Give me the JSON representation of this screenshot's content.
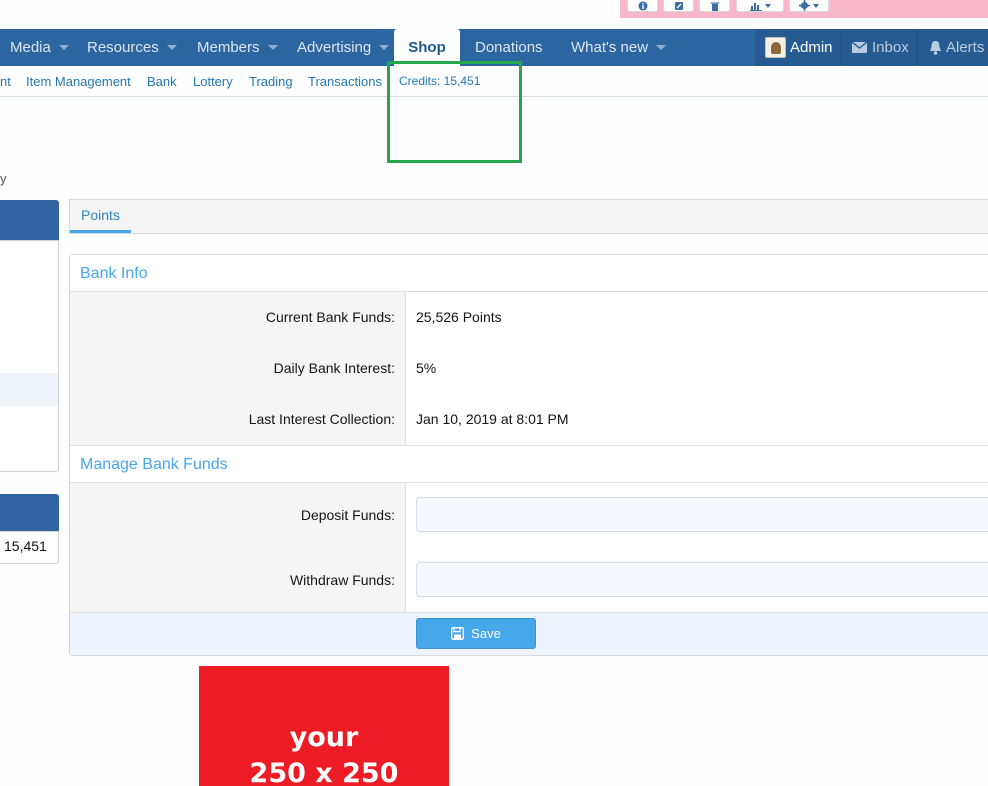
{
  "toolbar": {
    "buttons": [
      "info-icon",
      "edit-icon",
      "trash-icon",
      "chart-icon",
      "gear-icon"
    ]
  },
  "nav": {
    "items": [
      {
        "label": "Media"
      },
      {
        "label": "Resources"
      },
      {
        "label": "Members"
      },
      {
        "label": "Advertising"
      },
      {
        "label": "Shop"
      },
      {
        "label": "Donations"
      },
      {
        "label": "What's new"
      }
    ],
    "user": {
      "label": "Admin"
    },
    "inbox": {
      "label": "Inbox"
    },
    "alerts": {
      "label": "Alerts"
    }
  },
  "subnav": {
    "items": [
      {
        "label": "nt"
      },
      {
        "label": "Item Management"
      },
      {
        "label": "Bank"
      },
      {
        "label": "Lottery"
      },
      {
        "label": "Trading"
      },
      {
        "label": "Transactions"
      },
      {
        "label": "Credits: 15,451"
      }
    ]
  },
  "breadcrumb_fragment": "y",
  "sidebar": {
    "credits_value": "15,451"
  },
  "tabs": [
    {
      "label": "Points"
    }
  ],
  "bank_info": {
    "title": "Bank Info",
    "rows": [
      {
        "label": "Current Bank Funds:",
        "value": "25,526 Points"
      },
      {
        "label": "Daily Bank Interest:",
        "value": "5%"
      },
      {
        "label": "Last Interest Collection:",
        "value": "Jan 10, 2019 at 8:01 PM"
      }
    ]
  },
  "manage": {
    "title": "Manage Bank Funds",
    "deposit_label": "Deposit Funds:",
    "withdraw_label": "Withdraw Funds:",
    "deposit_value": "",
    "withdraw_value": "",
    "save_label": "Save"
  },
  "ad": {
    "line1": "your",
    "line2": "250 x 250"
  },
  "colors": {
    "nav_bg": "#2b66a1",
    "accent": "#47a7eb",
    "highlight_box": "#22a84a",
    "ad_bg": "#ed1c24"
  }
}
